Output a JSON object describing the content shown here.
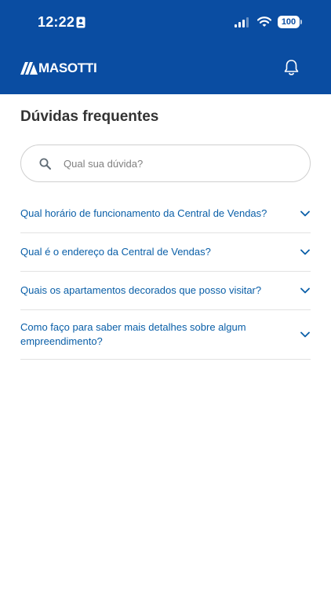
{
  "status_bar": {
    "time": "12:22",
    "battery": "100"
  },
  "header": {
    "logo_text": "MASOTTI"
  },
  "page": {
    "title": "Dúvidas frequentes"
  },
  "search": {
    "placeholder": "Qual sua dúvida?",
    "value": ""
  },
  "faq": {
    "items": [
      {
        "question": "Qual horário de funcionamento da Central de Vendas?"
      },
      {
        "question": "Qual é o endereço da Central de Vendas?"
      },
      {
        "question": "Quais os apartamentos decorados que posso visitar?"
      },
      {
        "question": "Como faço para saber mais detalhes sobre algum empreendimento?"
      }
    ]
  },
  "colors": {
    "header_bg": "#0a4da2",
    "link": "#0a5fa8",
    "title": "#333333",
    "divider": "#e2e2e2"
  },
  "icons": [
    "contact-card-icon",
    "signal-icon",
    "wifi-icon",
    "battery-icon",
    "logo-mark-icon",
    "bell-icon",
    "search-icon",
    "chevron-down-icon"
  ]
}
